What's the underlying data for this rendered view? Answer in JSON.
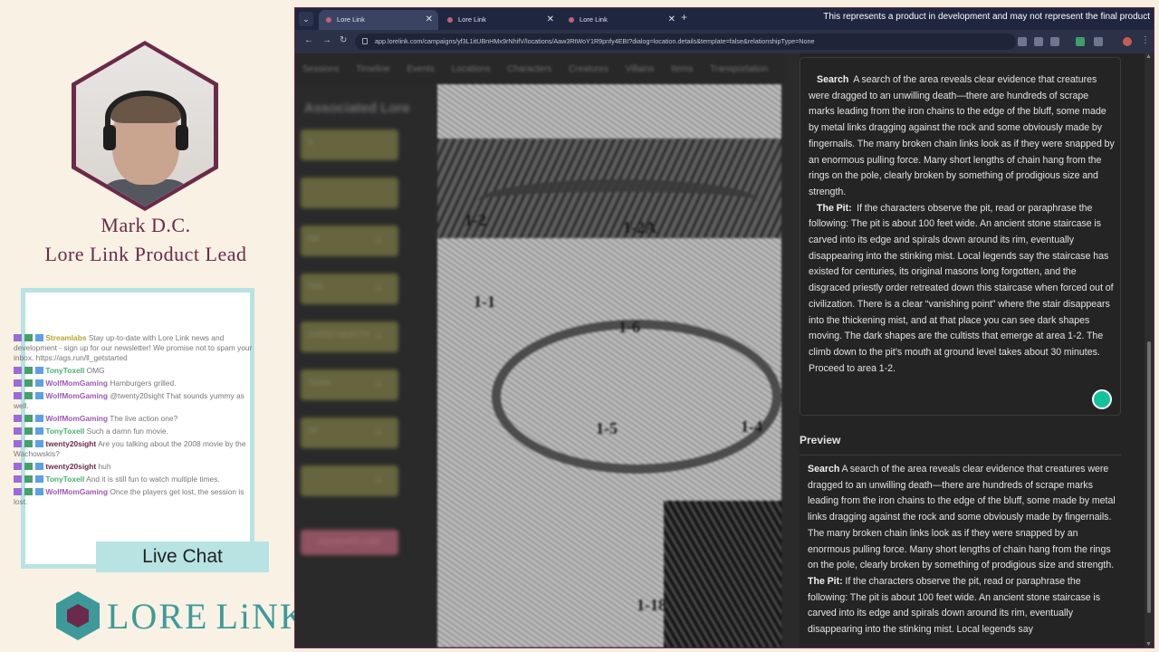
{
  "presenter": {
    "name": "Mark D.C.",
    "title": "Lore Link Product Lead"
  },
  "chat": {
    "label": "Live Chat",
    "messages": [
      {
        "user": "Streamlabs",
        "user_color": "#b8a22f",
        "text": "Stay up-to-date with Lore Link news and development - sign up for our newsletter! We promise not to spam your inbox. https://ags.run/ll_getstarted"
      },
      {
        "user": "TonyToxell",
        "user_color": "#4caf72",
        "text": "OMG"
      },
      {
        "user": "WolfMomGaming",
        "user_color": "#9b59b6",
        "text": "Hamburgers grilled."
      },
      {
        "user": "WolfMomGaming",
        "user_color": "#9b59b6",
        "text": "@twenty20sight That sounds yummy as well."
      },
      {
        "user": "WolfMomGaming",
        "user_color": "#9b59b6",
        "text": "The live action one?"
      },
      {
        "user": "TonyToxell",
        "user_color": "#4caf72",
        "text": "Such a damn fun movie."
      },
      {
        "user": "twenty20sight",
        "user_color": "#6b2a4a",
        "text": "Are you talking about the 2008 movie by the Wachowskis?"
      },
      {
        "user": "twenty20sight",
        "user_color": "#6b2a4a",
        "text": "huh"
      },
      {
        "user": "TonyToxell",
        "user_color": "#4caf72",
        "text": "And it is still fun to watch multiple times."
      },
      {
        "user": "WolfMomGaming",
        "user_color": "#9b59b6",
        "text": "Once the players get lost, the session is lost."
      }
    ]
  },
  "logo": {
    "text_left": "LORE",
    "text_right": "LiNK"
  },
  "browser": {
    "banner": "This represents a product in development and may not represent the final product",
    "tabs": [
      {
        "label": "Lore Link"
      },
      {
        "label": "Lore Link"
      },
      {
        "label": "Lore Link"
      }
    ],
    "url": "app.lorelink.com/campaigns/yf3L1itUBnHMx9rNhifV/locations/Aaw3RtWoY1R9pnfy4EBI?dialog=location.details&template=false&relationshipType=None"
  },
  "app": {
    "nav": [
      "Sessions",
      "Timeline",
      "Events",
      "Locations",
      "Characters",
      "Creatures",
      "Villains",
      "Items",
      "Transportation"
    ],
    "sidebar": {
      "title": "Associated Lore",
      "items": [
        {
          "label": "X",
          "count": ""
        },
        {
          "label": "",
          "count": ""
        },
        {
          "label": "EM",
          "count": "0"
        },
        {
          "label": "PEN",
          "count": "0"
        },
        {
          "label": "CIATED OBJECTS",
          "count": "0"
        },
        {
          "label": "TIONS",
          "count": "0"
        },
        {
          "label": "SV",
          "count": "0"
        },
        {
          "label": "",
          "count": "0"
        }
      ],
      "button": "ASSOCIATE LORE"
    },
    "map_labels": [
      "1-2",
      "1-2A",
      "1-1",
      "1-6",
      "1-5",
      "1-4",
      "1-18"
    ],
    "editor": {
      "search_heading": "Search",
      "search_text": "A search of the area reveals clear evidence that creatures were dragged to an unwilling death—there are hundreds of scrape marks leading from the iron chains to the edge of the bluff, some made by metal links dragging against the rock and some obviously made by fingernails. The many broken chain links look as if they were snapped by an enormous pulling force. Many short lengths of chain hang from the rings on the pole, clearly broken by something of prodigious size and strength.",
      "pit_heading": "The Pit:",
      "pit_text": "If the characters observe the pit, read or paraphrase the following: The pit is about 100 feet wide. An ancient stone staircase is carved into its edge and spirals down around its rim, eventually disappearing into the stinking mist. Local legends say the staircase has existed for centuries, its original masons long forgotten, and the disgraced priestly order retreated down this staircase when forced out of civilization. There is a clear “vanishing point” where the stair disappears into the thickening mist, and at that place you can see dark shapes moving. The dark shapes are the cultists that emerge at area 1-2. The climb down to the pit’s mouth at ground level takes about 30 minutes. Proceed to area 1-2."
    },
    "preview": {
      "heading": "Preview",
      "search_heading": "Search",
      "search_text": "A search of the area reveals clear evidence that creatures were dragged to an unwilling death—there are hundreds of scrape marks leading from the iron chains to the edge of the bluff, some made by metal links dragging against the rock and some obviously made by fingernails. The many broken chain links look as if they were snapped by an enormous pulling force. Many short lengths of chain hang from the rings on the pole, clearly broken by something of prodigious size and strength.",
      "pit_heading": "The Pit:",
      "pit_text": "If the characters observe the pit, read or paraphrase the following: The pit is about 100 feet wide. An ancient stone staircase is carved into its edge and spirals down around its rim, eventually disappearing into the stinking mist. Local legends say"
    }
  },
  "colors": {
    "brand_plum": "#6b2a4a",
    "brand_teal": "#3e9a9a",
    "chat_border": "#b7e3e2",
    "sidebar_olive": "#66653d",
    "grammarly": "#15c39a"
  }
}
